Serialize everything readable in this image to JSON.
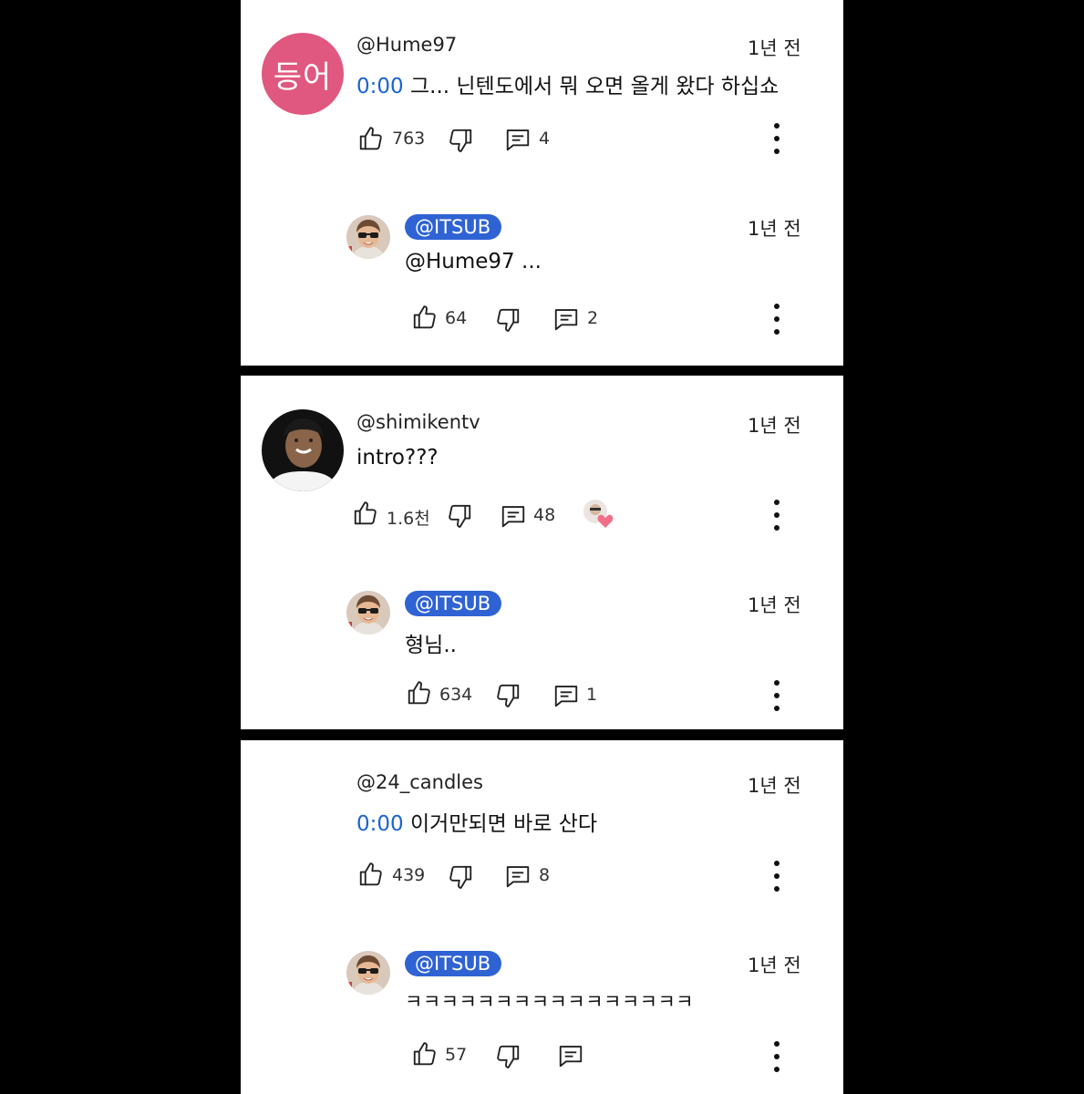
{
  "comments": [
    {
      "avatar_text": "등어",
      "username": "@Hume97",
      "time": "1년 전",
      "timestamp": "0:00",
      "text": " 그... 닌텐도에서 뭐 오면 올게 왔다 하십쇼",
      "likes": "763",
      "replies": "4",
      "reply": {
        "author": "@ITSUB",
        "time": "1년 전",
        "text": "@Hume97 ...",
        "likes": "64",
        "replies": "2"
      }
    },
    {
      "username": "@shimikentv",
      "time": "1년 전",
      "text": "intro???",
      "likes": "1.6천",
      "replies": "48",
      "reply": {
        "author": "@ITSUB",
        "time": "1년 전",
        "text": "형님..",
        "likes": "634",
        "replies": "1"
      }
    },
    {
      "username": "@24_candles",
      "time": "1년 전",
      "timestamp": "0:00",
      "text": " 이거만되면 바로 산다",
      "likes": "439",
      "replies": "8",
      "reply": {
        "author": "@ITSUB",
        "time": "1년 전",
        "text": "ㅋㅋㅋㅋㅋㅋㅋㅋㅋㅋㅋㅋㅋㅋㅋㅋ",
        "likes": "57",
        "replies": ""
      }
    }
  ],
  "icons": {
    "like": "thumbs-up-icon",
    "dislike": "thumbs-down-icon",
    "reply": "comment-icon",
    "menu": "more-vert-icon",
    "heart": "creator-heart-icon"
  },
  "colors": {
    "timestamp": "#1a63d4",
    "badge": "#2f63d3",
    "avatar_pink": "#e0587f"
  }
}
